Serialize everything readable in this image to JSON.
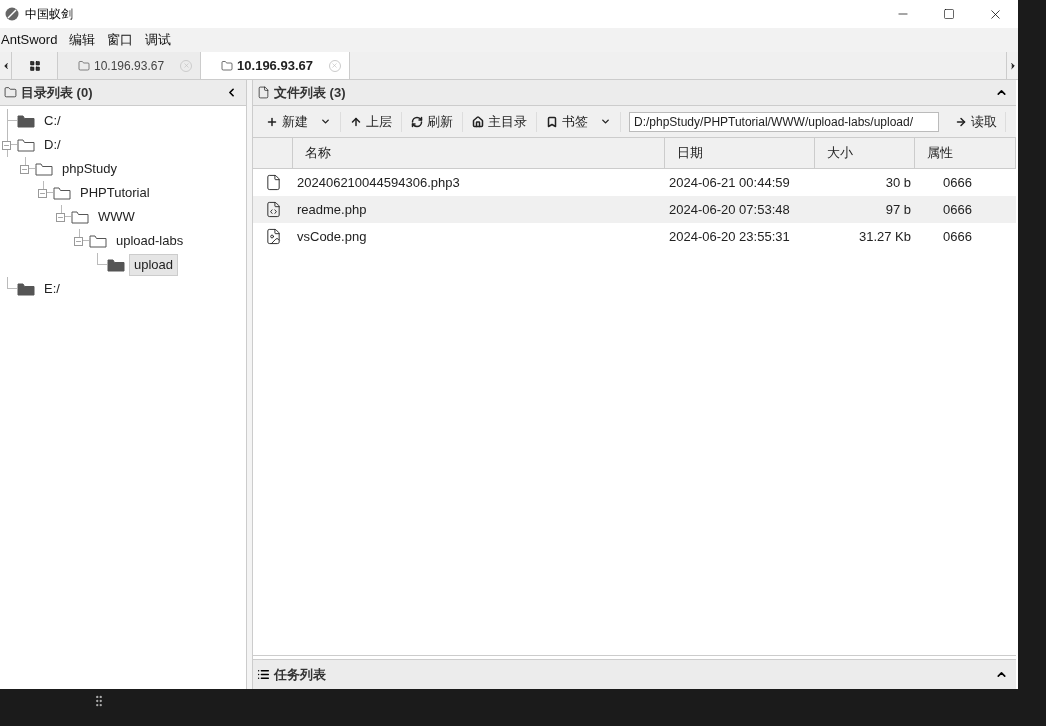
{
  "window": {
    "title": "中国蚁剑"
  },
  "menu": [
    "AntSword",
    "编辑",
    "窗口",
    "调试"
  ],
  "tabs": [
    {
      "label": "10.196.93.67",
      "selected": false
    },
    {
      "label": "10.196.93.67",
      "selected": true
    }
  ],
  "dir_panel": {
    "title": "目录列表 (0)",
    "tree": [
      {
        "label": "C:/",
        "expanded": false,
        "selected": false
      },
      {
        "label": "D:/",
        "expanded": true,
        "selected": false,
        "children": [
          {
            "label": "phpStudy",
            "expanded": true,
            "selected": false,
            "children": [
              {
                "label": "PHPTutorial",
                "expanded": true,
                "selected": false,
                "children": [
                  {
                    "label": "WWW",
                    "expanded": true,
                    "selected": false,
                    "children": [
                      {
                        "label": "upload-labs",
                        "expanded": true,
                        "selected": false,
                        "children": [
                          {
                            "label": "upload",
                            "expanded": false,
                            "selected": true
                          }
                        ]
                      }
                    ]
                  }
                ]
              }
            ]
          }
        ]
      },
      {
        "label": "E:/",
        "expanded": false,
        "selected": false
      }
    ]
  },
  "file_panel": {
    "title": "文件列表 (3)",
    "toolbar": [
      {
        "kind": "new",
        "label": "新建",
        "dropdown": true
      },
      {
        "kind": "up",
        "label": "上层",
        "dropdown": false
      },
      {
        "kind": "refresh",
        "label": "刷新",
        "dropdown": false
      },
      {
        "kind": "home",
        "label": "主目录",
        "dropdown": false
      },
      {
        "kind": "bookmark",
        "label": "书签",
        "dropdown": true
      }
    ],
    "path": "D:/phpStudy/PHPTutorial/WWW/upload-labs/upload/",
    "read_button": "读取",
    "columns": [
      "名称",
      "日期",
      "大小",
      "属性"
    ],
    "rows": [
      {
        "kind": "file",
        "name": "202406210044594306.php3",
        "date": "2024-06-21 00:44:59",
        "size": "30 b",
        "attr": "0666",
        "selected": false
      },
      {
        "kind": "code",
        "name": "readme.php",
        "date": "2024-06-20 07:53:48",
        "size": "97 b",
        "attr": "0666",
        "selected": true
      },
      {
        "kind": "image",
        "name": "vsCode.png",
        "date": "2024-06-20 23:55:31",
        "size": "31.27 Kb",
        "attr": "0666",
        "selected": false
      }
    ]
  },
  "task_panel": {
    "title": "任务列表"
  }
}
